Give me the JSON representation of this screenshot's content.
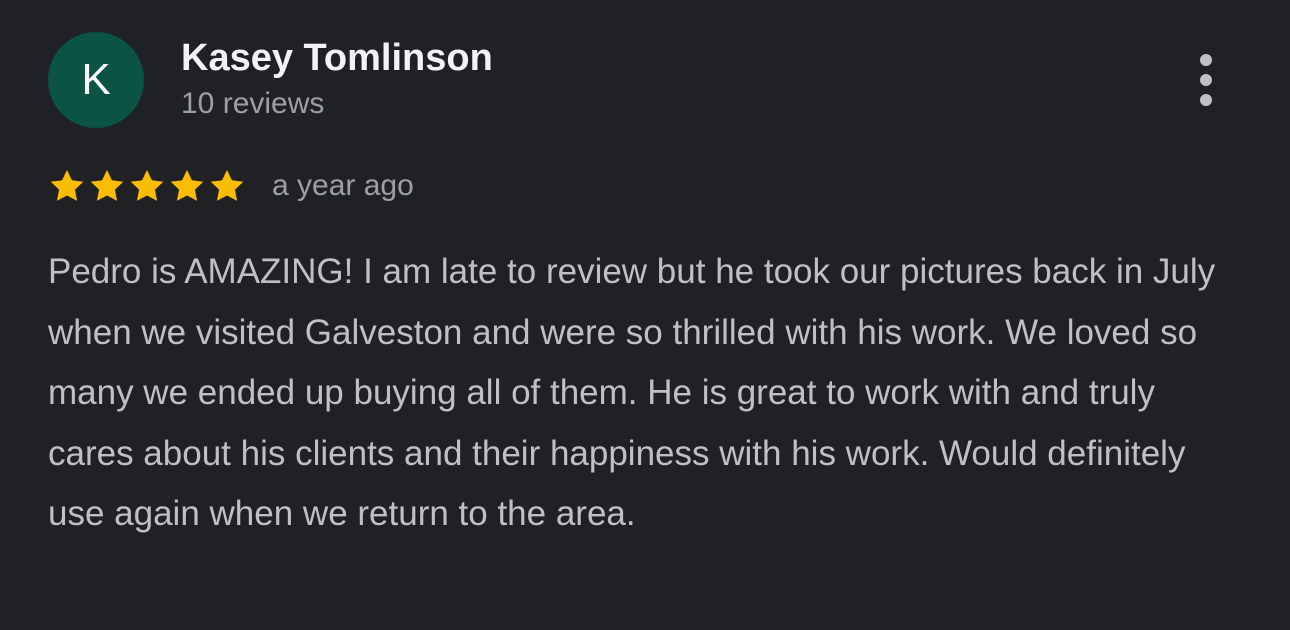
{
  "reviewer": {
    "initial": "K",
    "avatar_color": "#0b5345",
    "name": "Kasey Tomlinson",
    "review_count": "10 reviews"
  },
  "menu": {
    "icon": "more-vert-icon"
  },
  "review": {
    "rating": 5,
    "max_rating": 5,
    "star_color": "#fbbc04",
    "timestamp": "a year ago",
    "text": "Pedro is AMAZING! I am late to review but he took our pictures back in July when we visited Galveston and were so thrilled with his work. We loved so many we ended up buying all of them. He is great to work with and truly cares about his clients and their happiness with his work. Would definitely use again when we return to the area."
  }
}
